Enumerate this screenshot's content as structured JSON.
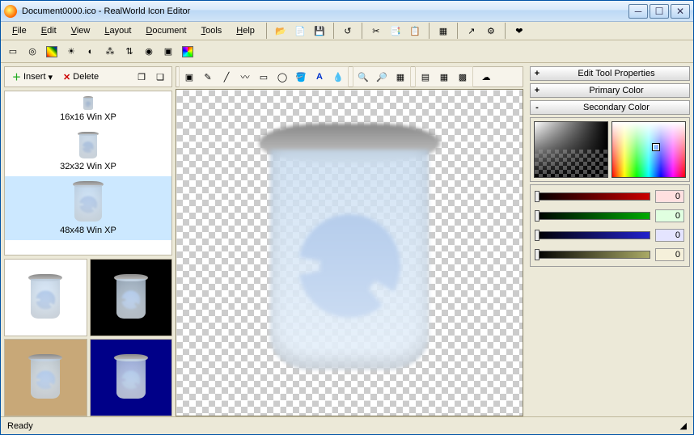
{
  "window": {
    "title": "Document0000.ico - RealWorld Icon Editor"
  },
  "menu": [
    "File",
    "Edit",
    "View",
    "Layout",
    "Document",
    "Tools",
    "Help"
  ],
  "listbar": {
    "insert": "Insert",
    "delete": "Delete"
  },
  "images": [
    {
      "label": "16x16 Win XP",
      "size": 16
    },
    {
      "label": "32x32 Win XP",
      "size": 32
    },
    {
      "label": "48x48 Win XP",
      "size": 48,
      "selected": true
    }
  ],
  "panels": {
    "edit": "Edit Tool Properties",
    "primary": "Primary Color",
    "secondary": "Secondary Color"
  },
  "sliders": [
    {
      "color": "#c00",
      "bg": "#ffe0e0",
      "value": "0"
    },
    {
      "color": "#0a0",
      "bg": "#e0ffe0",
      "value": "0"
    },
    {
      "color": "#22c",
      "bg": "#e4e4ff",
      "value": "0"
    },
    {
      "color": "#aa6",
      "bg": "#f5f0da",
      "value": "0"
    }
  ],
  "status": "Ready",
  "previews": [
    "#ffffff",
    "#000000",
    "#c8a878",
    "#000088"
  ]
}
